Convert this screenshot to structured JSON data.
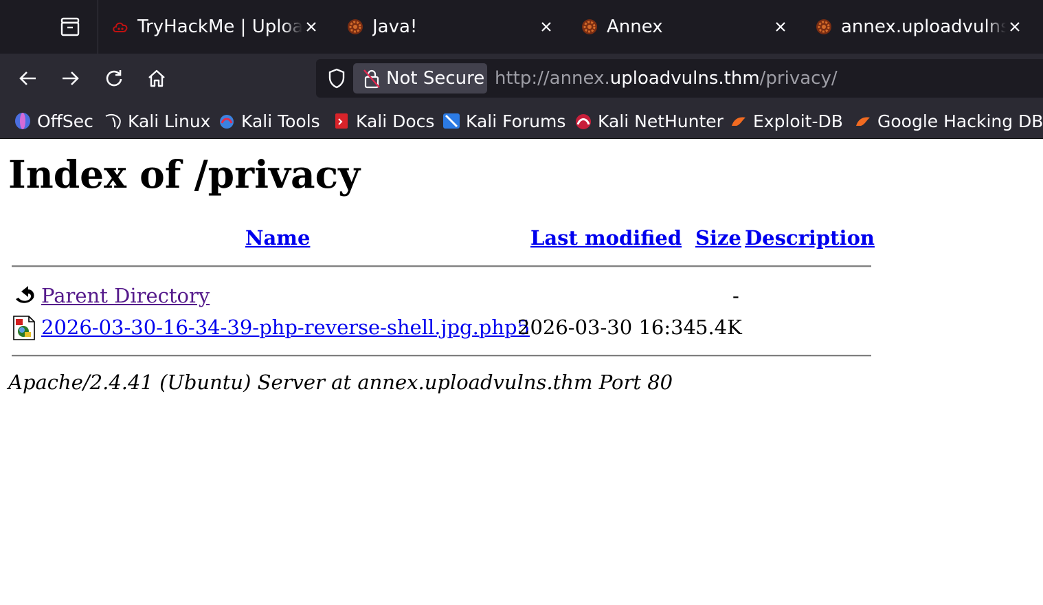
{
  "browser": {
    "tabs": [
      {
        "title": "TryHackMe | Upload Vulnerabilities",
        "favicon": "tryhackme-cloud-icon",
        "active": false
      },
      {
        "title": "Java!",
        "favicon": "site-gear-icon",
        "active": false
      },
      {
        "title": "Annex",
        "favicon": "site-gear-icon",
        "active": false
      },
      {
        "title": "annex.uploadvulns.thm/privacy/",
        "favicon": "site-gear-icon",
        "active": true
      }
    ],
    "security_label": "Not Secure",
    "url": {
      "prefix": "http://annex.",
      "host": "uploadvulns.thm",
      "path": "/privacy/"
    },
    "bookmarks": [
      {
        "label": "OffSec",
        "icon": "offsec-icon"
      },
      {
        "label": "Kali Linux",
        "icon": "kali-dragon-icon"
      },
      {
        "label": "Kali Tools",
        "icon": "kali-tools-icon"
      },
      {
        "label": "Kali Docs",
        "icon": "kali-docs-icon"
      },
      {
        "label": "Kali Forums",
        "icon": "kali-forums-icon"
      },
      {
        "label": "Kali NetHunter",
        "icon": "nethunter-icon"
      },
      {
        "label": "Exploit-DB",
        "icon": "exploit-db-icon"
      },
      {
        "label": "Google Hacking DB",
        "icon": "ghdb-icon"
      }
    ]
  },
  "page": {
    "title": "Index of /privacy",
    "columns": {
      "name": "Name",
      "last_modified": "Last modified",
      "size": "Size",
      "description": "Description"
    },
    "rows": [
      {
        "name": "Parent Directory",
        "last_modified": "",
        "size": "-",
        "description": "",
        "icon": "back-arrow-icon",
        "visited": true
      },
      {
        "name": "2026-03-30-16-34-39-php-reverse-shell.jpg.php5",
        "last_modified": "2026-03-30 16:34",
        "size": "5.4K",
        "description": "",
        "icon": "image-file-icon",
        "visited": false
      }
    ],
    "footer": "Apache/2.4.41 (Ubuntu) Server at annex.uploadvulns.thm Port 80"
  },
  "colors": {
    "link": "#0000ee",
    "visited_link": "#551a8b",
    "chrome_dark": "#1c1b22",
    "toolbar": "#2b2a33"
  }
}
